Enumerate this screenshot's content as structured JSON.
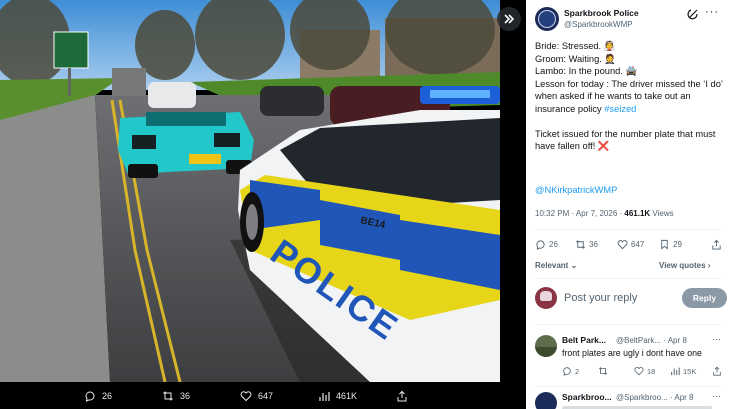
{
  "media": {
    "expand_icon": "double-chevron-right-icon",
    "number_plate_text": "BE14",
    "police_livery_text": "POLICE",
    "stats": {
      "replies": "26",
      "reposts": "36",
      "likes": "647",
      "views": "461K"
    }
  },
  "post": {
    "author_name": "Sparkbrook Police",
    "author_handle": "@SparkbrookWMP",
    "lines": [
      "Bride: Stressed. 👰",
      "Groom: Waiting. 🤵",
      "Lambo: In the pound. 🚔",
      "Lesson for today : The driver missed the ‘I do’ when asked if he wants to take out an insurance policy"
    ],
    "hashtag": "#seized",
    "paragraph2": "Ticket issued for the number plate that must have fallen off! ❌",
    "mention": "@NKirkpatrickWMP",
    "time": "10:32 PM · Apr 7, 2026 · ",
    "views_count": "461.1K",
    "views_label": " Views",
    "actions": {
      "replies": "26",
      "reposts": "36",
      "likes": "647",
      "bookmarks": "29"
    },
    "sort_label": "Relevant",
    "view_quotes_label": "View quotes"
  },
  "reply_composer": {
    "placeholder": "Post your reply",
    "button_label": "Reply"
  },
  "replies": [
    {
      "name": "Belt Park...",
      "handle": "@BeltPark...",
      "date": "· Apr 8",
      "text": "front plates are ugly i dont have one",
      "replies": "2",
      "reposts": "",
      "likes": "18",
      "views": "15K"
    },
    {
      "name": "Sparkbroo...",
      "handle": "@Sparkbroo...",
      "date": "· Apr 8"
    }
  ],
  "colors": {
    "accent": "#1d9bf0",
    "police_blue": "#1f56b8",
    "police_yellow": "#e7d51a",
    "lambo_teal": "#22c7c9"
  }
}
